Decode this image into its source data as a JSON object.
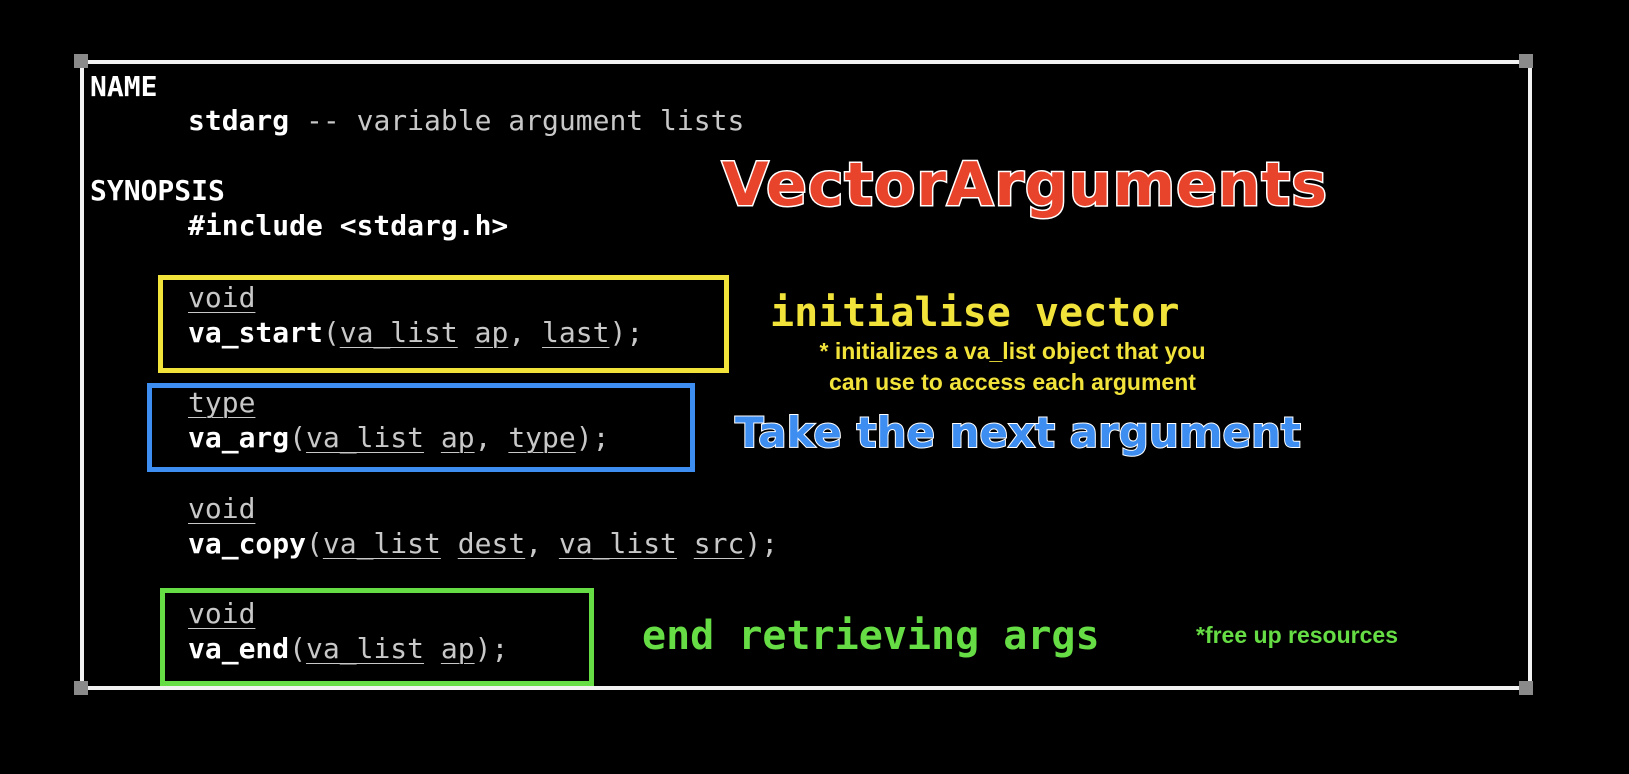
{
  "manpage": {
    "name_heading": "NAME",
    "name_command": "stdarg",
    "name_description": " -- variable argument lists",
    "synopsis_heading": "SYNOPSIS",
    "include_line": "#include <stdarg.h>",
    "functions": [
      {
        "return_type": "void",
        "name": "va_start",
        "params": [
          {
            "type": "va_list",
            "name": "ap"
          },
          {
            "name": "last"
          }
        ]
      },
      {
        "return_type": "type",
        "name": "va_arg",
        "params": [
          {
            "type": "va_list",
            "name": "ap"
          },
          {
            "name": "type"
          }
        ]
      },
      {
        "return_type": "void",
        "name": "va_copy",
        "params": [
          {
            "type": "va_list",
            "name": "dest"
          },
          {
            "type": "va_list",
            "name": "src"
          }
        ]
      },
      {
        "return_type": "void",
        "name": "va_end",
        "params": [
          {
            "type": "va_list",
            "name": "ap"
          }
        ]
      }
    ]
  },
  "annotations": {
    "title": "VectorArguments",
    "start_heading": "initialise vector",
    "start_note_line1": "* initializes a va_list object that you",
    "start_note_line2": "can use to access each argument",
    "arg_heading": "Take the next argument",
    "end_heading": "end retrieving args",
    "end_note": "*free up resources"
  },
  "colors": {
    "title": "#e8432b",
    "start": "#f2e33b",
    "arg": "#3d8ef0",
    "end": "#66dd44",
    "frame": "#f2f2f2",
    "background": "#000000"
  }
}
